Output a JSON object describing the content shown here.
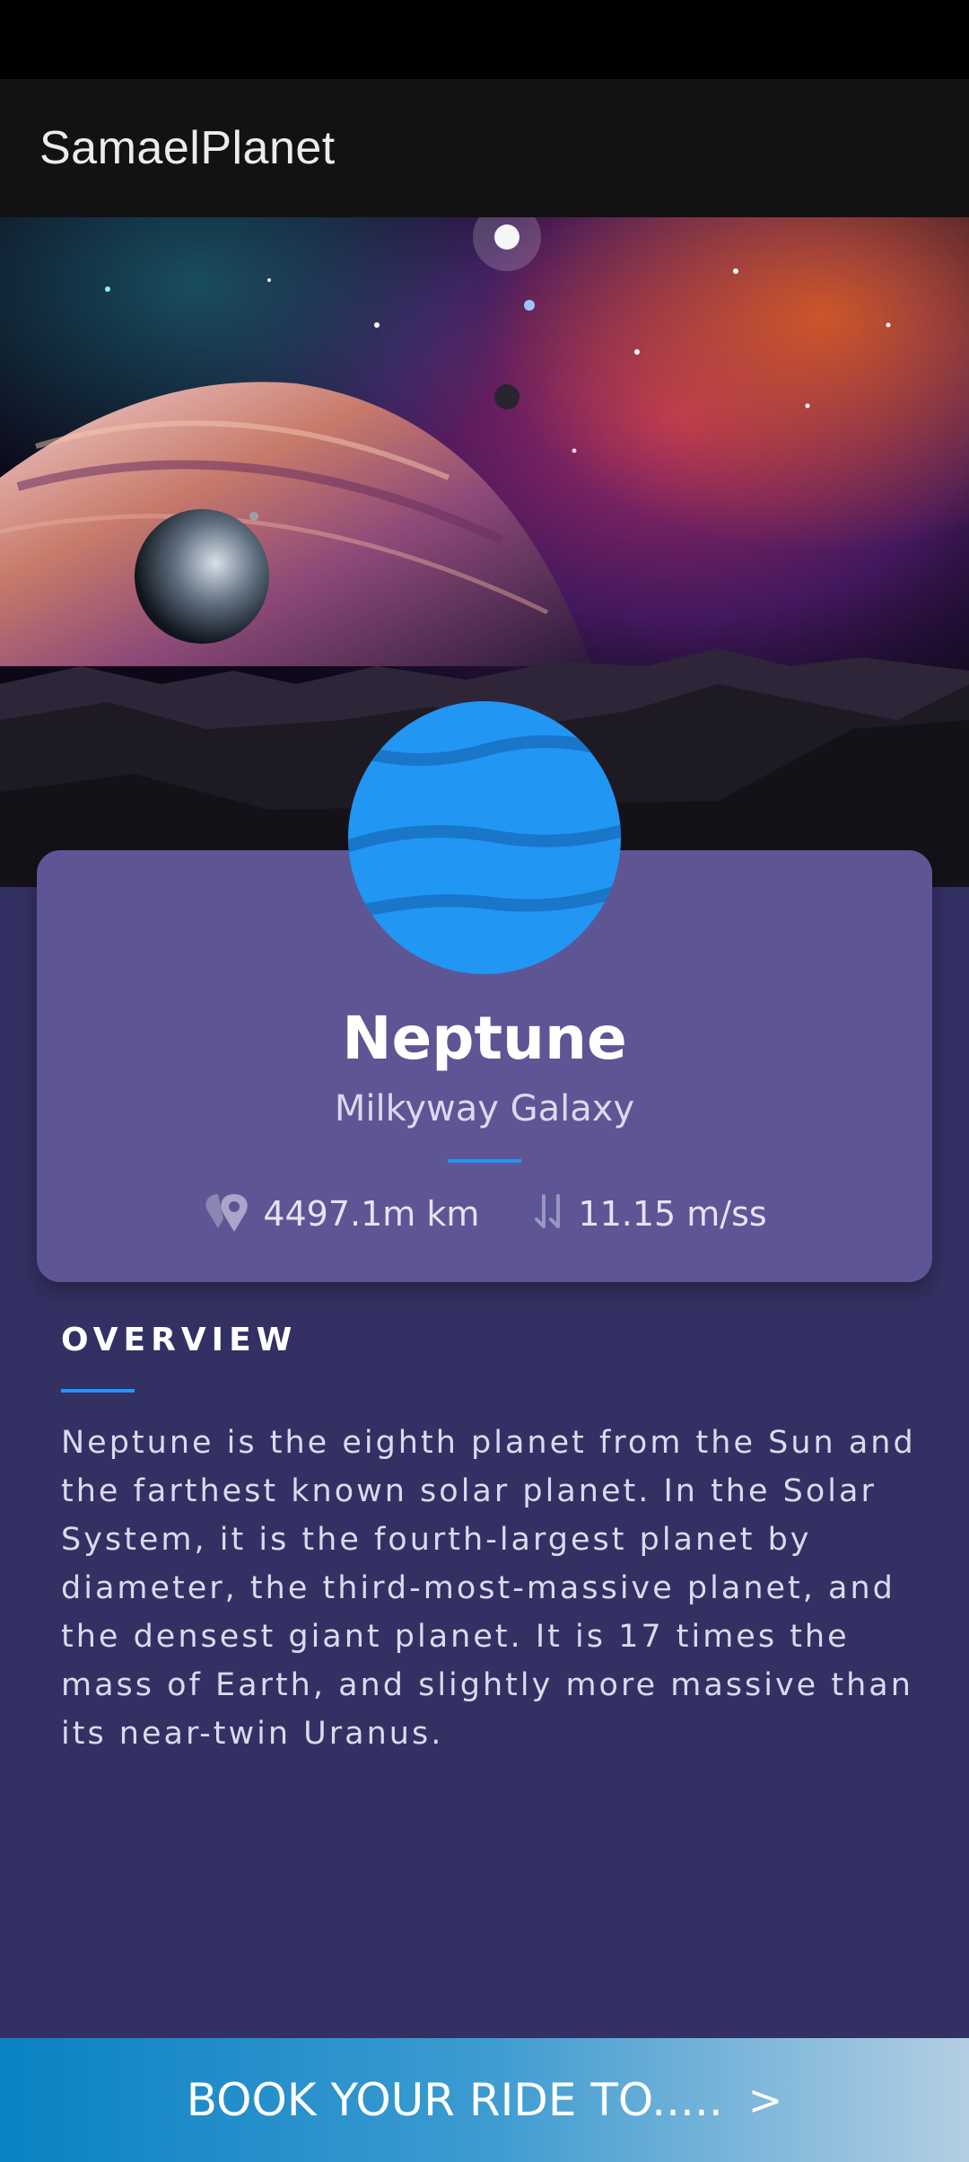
{
  "app": {
    "title": "SamaelPlanet"
  },
  "planet": {
    "name": "Neptune",
    "galaxy": "Milkyway Galaxy",
    "distance": "4497.1m km",
    "gravity": "11.15 m/ss",
    "icon": "neptune-planet-icon",
    "color": "#2196f3"
  },
  "overview": {
    "heading": "OVERVIEW",
    "text": "Neptune is the eighth planet from the Sun and the farthest known solar planet. In the Solar System, it is the fourth-largest planet by diameter, the third-most-massive planet, and the densest giant planet. It is 17 times the mass of Earth, and slightly more massive than its near-twin Uranus."
  },
  "cta": {
    "label": "BOOK YOUR RIDE TO.....",
    "icon": "chevron-right-icon"
  },
  "icons": {
    "distance": "location-pin-icon",
    "gravity": "gravity-arrows-icon"
  },
  "colors": {
    "background": "#333063",
    "card": "#5e5594",
    "accent": "#2196f3",
    "app_bar": "#121212"
  }
}
